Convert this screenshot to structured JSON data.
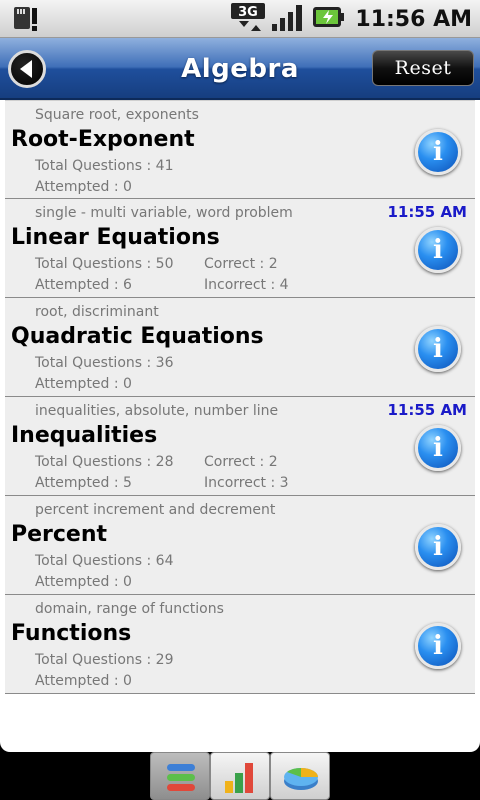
{
  "status_bar": {
    "time": "11:56 AM",
    "network": "3G"
  },
  "header": {
    "title": "Algebra",
    "reset_label": "Reset"
  },
  "topics": [
    {
      "subtitle": "Square root, exponents",
      "name": "Root-Exponent",
      "total": "Total Questions : 41",
      "attempted": "Attempted : 0",
      "time": "",
      "correct": "",
      "incorrect": ""
    },
    {
      "subtitle": "single - multi variable, word problem",
      "name": "Linear Equations",
      "total": "Total Questions : 50",
      "attempted": "Attempted : 6",
      "time": "11:55 AM",
      "correct": "Correct : 2",
      "incorrect": "Incorrect : 4"
    },
    {
      "subtitle": "root, discriminant",
      "name": "Quadratic Equations",
      "total": "Total Questions : 36",
      "attempted": "Attempted : 0",
      "time": "",
      "correct": "",
      "incorrect": ""
    },
    {
      "subtitle": "inequalities, absolute, number line",
      "name": "Inequalities",
      "total": "Total Questions : 28",
      "attempted": "Attempted : 5",
      "time": "11:55 AM",
      "correct": "Correct : 2",
      "incorrect": "Incorrect : 3"
    },
    {
      "subtitle": "percent increment and decrement",
      "name": "Percent",
      "total": "Total Questions : 64",
      "attempted": "Attempted : 0",
      "time": "",
      "correct": "",
      "incorrect": ""
    },
    {
      "subtitle": "domain, range of functions",
      "name": "Functions",
      "total": "Total Questions : 29",
      "attempted": "Attempted : 0",
      "time": "",
      "correct": "",
      "incorrect": ""
    }
  ],
  "icons": {
    "info": "info-icon",
    "back": "back-arrow-icon",
    "tab_list": "list-icon",
    "tab_bar_chart": "bar-chart-icon",
    "tab_pie_chart": "pie-chart-icon"
  },
  "colors": {
    "title_bar": "#2b5ca8",
    "time_accent": "#1a1ac8",
    "info_blue": "#2a8ff0"
  }
}
